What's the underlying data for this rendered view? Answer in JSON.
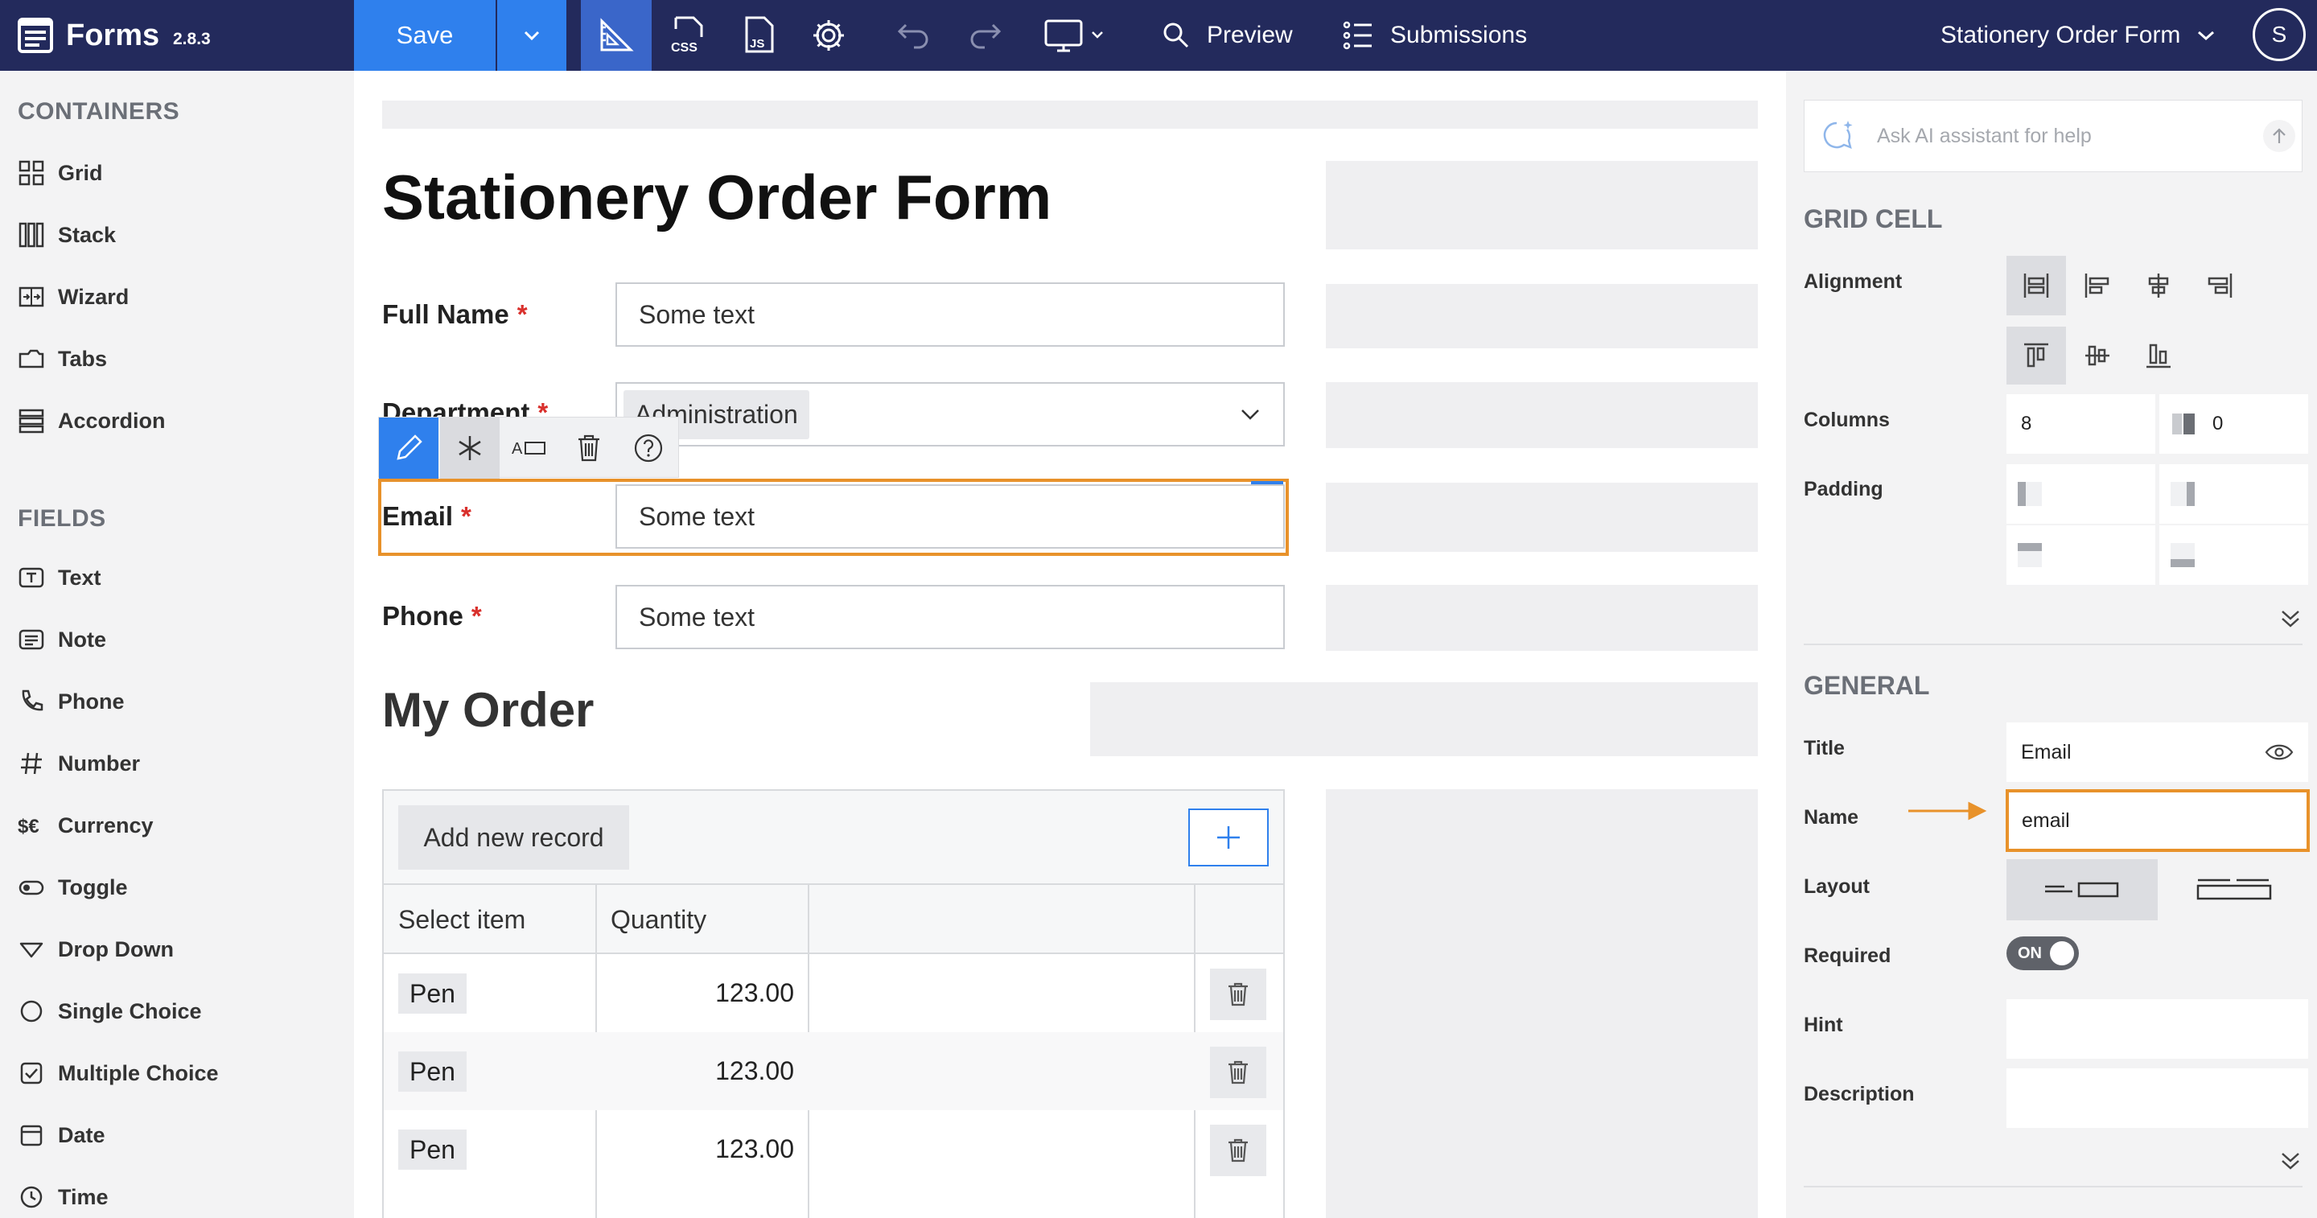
{
  "app": {
    "name": "Forms",
    "version": "2.8.3"
  },
  "toolbar": {
    "save_label": "Save",
    "preview_label": "Preview",
    "submissions_label": "Submissions",
    "form_selector": "Stationery Order Form",
    "avatar_initial": "S",
    "accent_color": "#2f80ed",
    "bar_color": "#232a5c"
  },
  "left": {
    "containers_title": "CONTAINERS",
    "containers": [
      {
        "label": "Grid",
        "icon": "grid-icon"
      },
      {
        "label": "Stack",
        "icon": "stack-icon"
      },
      {
        "label": "Wizard",
        "icon": "wizard-icon"
      },
      {
        "label": "Tabs",
        "icon": "tabs-icon"
      },
      {
        "label": "Accordion",
        "icon": "accordion-icon"
      }
    ],
    "fields_title": "FIELDS",
    "fields": [
      {
        "label": "Text",
        "icon": "text-icon"
      },
      {
        "label": "Note",
        "icon": "note-icon"
      },
      {
        "label": "Phone",
        "icon": "phone-icon"
      },
      {
        "label": "Number",
        "icon": "hash-icon"
      },
      {
        "label": "Currency",
        "icon": "currency-icon"
      },
      {
        "label": "Toggle",
        "icon": "toggle-icon"
      },
      {
        "label": "Drop Down",
        "icon": "dropdown-icon"
      },
      {
        "label": "Single Choice",
        "icon": "radio-icon"
      },
      {
        "label": "Multiple Choice",
        "icon": "checkbox-icon"
      },
      {
        "label": "Date",
        "icon": "calendar-icon"
      },
      {
        "label": "Time",
        "icon": "clock-icon"
      }
    ]
  },
  "form": {
    "title": "Stationery Order Form",
    "fields": {
      "full_name": {
        "label": "Full Name",
        "value": "Some text",
        "required": "*"
      },
      "department": {
        "label": "Department",
        "value": "Administration",
        "required": "*"
      },
      "email": {
        "label": "Email",
        "value": "Some text",
        "required": "*"
      },
      "phone": {
        "label": "Phone",
        "value": "Some text",
        "required": "*"
      }
    },
    "order_title": "My Order",
    "table": {
      "add_button": "Add new record",
      "columns": [
        "Select item",
        "Quantity"
      ],
      "rows": [
        {
          "item": "Pen",
          "quantity": "123.00"
        },
        {
          "item": "Pen",
          "quantity": "123.00"
        },
        {
          "item": "Pen",
          "quantity": "123.00"
        }
      ]
    },
    "selection_color": "#e8922b"
  },
  "right": {
    "ai_placeholder": "Ask AI assistant for help",
    "grid_cell_title": "GRID CELL",
    "alignment_label": "Alignment",
    "columns_label": "Columns",
    "columns_value": "8",
    "offset_value": "0",
    "padding_label": "Padding",
    "general_title": "GENERAL",
    "title_label": "Title",
    "title_value": "Email",
    "name_label": "Name",
    "name_value": "email",
    "layout_label": "Layout",
    "required_label": "Required",
    "required_toggle": "ON",
    "hint_label": "Hint",
    "description_label": "Description"
  }
}
